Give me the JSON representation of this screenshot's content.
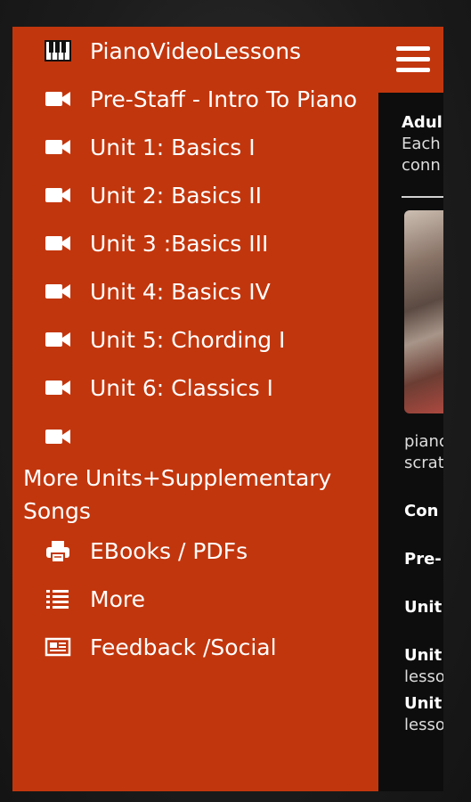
{
  "colors": {
    "accent": "#c2360d",
    "text": "#ffffff",
    "page_bg": "#0d0d0d"
  },
  "drawer": {
    "items": [
      {
        "label": "PianoVideoLessons",
        "icon": "piano-keys-icon"
      },
      {
        "label": "Pre-Staff - Intro To Piano",
        "icon": "video-camera-icon"
      },
      {
        "label": "Unit 1: Basics I",
        "icon": "video-camera-icon"
      },
      {
        "label": "Unit 2: Basics II",
        "icon": "video-camera-icon"
      },
      {
        "label": "Unit 3 :Basics III",
        "icon": "video-camera-icon"
      },
      {
        "label": "Unit 4: Basics IV",
        "icon": "video-camera-icon"
      },
      {
        "label": "Unit 5: Chording I",
        "icon": "video-camera-icon"
      },
      {
        "label": "Unit 6: Classics I",
        "icon": "video-camera-icon"
      },
      {
        "label": "More Units+Supplementary Songs",
        "icon": "video-camera-icon"
      },
      {
        "label": "EBooks / PDFs",
        "icon": "printer-icon"
      },
      {
        "label": "More",
        "icon": "list-icon"
      },
      {
        "label": "Feedback /Social",
        "icon": "newspaper-icon"
      }
    ]
  },
  "page": {
    "menu_icon": "hamburger-menu-icon",
    "intro_title": "Adul",
    "intro_text_1": "Each",
    "intro_text_2": "conn",
    "caption_1": "pianc",
    "caption_2": "scrat",
    "list": [
      {
        "title": "Con",
        "sub": ""
      },
      {
        "title": "Pre-",
        "sub": ""
      },
      {
        "title": "Unit",
        "sub": ""
      },
      {
        "title": "Unit",
        "sub": "lesso"
      },
      {
        "title": "Unit",
        "sub": "lesso"
      }
    ]
  }
}
